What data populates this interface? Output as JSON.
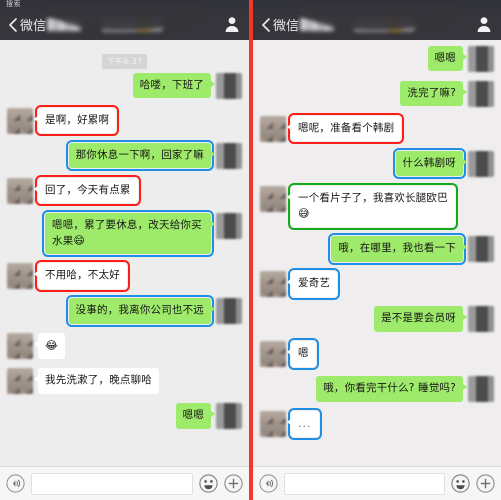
{
  "app": {
    "name": "WeChat",
    "accent_green": "#9eea6a",
    "divider_color": "#f0392b",
    "nav_bg": "#36353b"
  },
  "panels": [
    {
      "id": "left",
      "statusbar_text": "搜索",
      "nav": {
        "back_label": "微信",
        "contact_name_redacted": "▮▮▮▮",
        "title_redacted": "▮▮▮▮▮",
        "profile_icon": "person-icon"
      },
      "timestamp": "下午6:37",
      "messages": [
        {
          "side": "out",
          "type": "text",
          "text": "哈喽，下班了",
          "bubble": "green",
          "highlight": "none"
        },
        {
          "side": "in",
          "type": "text",
          "text": "是啊，好累啊",
          "bubble": "white",
          "highlight": "red"
        },
        {
          "side": "out",
          "type": "text",
          "text": "那你休息一下啊，回家了嘛",
          "bubble": "green",
          "highlight": "blue"
        },
        {
          "side": "in",
          "type": "text",
          "text": "回了，今天有点累",
          "bubble": "white",
          "highlight": "red"
        },
        {
          "side": "out",
          "type": "text",
          "text": "嗯嗯，累了要休息，改天给你买水果",
          "emoji": "😄",
          "bubble": "green",
          "highlight": "blue"
        },
        {
          "side": "in",
          "type": "text",
          "text": "不用哈，不太好",
          "bubble": "white",
          "highlight": "red"
        },
        {
          "side": "out",
          "type": "text",
          "text": "没事的，我离你公司也不远",
          "bubble": "green",
          "highlight": "blue"
        },
        {
          "side": "in",
          "type": "emoji",
          "text": "😂",
          "bubble": "white",
          "highlight": "none"
        },
        {
          "side": "in",
          "type": "text",
          "text": "我先洗漱了，晚点聊哈",
          "bubble": "white",
          "highlight": "none"
        },
        {
          "side": "out",
          "type": "text",
          "text": "嗯嗯",
          "bubble": "green",
          "highlight": "none"
        }
      ],
      "input": {
        "voice_icon": "voice-icon",
        "placeholder": "",
        "value": "",
        "emoji_icon": "smiley-icon",
        "plus_icon": "plus-icon"
      }
    },
    {
      "id": "right",
      "statusbar_text": "",
      "nav": {
        "back_label": "微信",
        "contact_name_redacted": "▮▮▮▮",
        "title_redacted": "▮▮▮▮▮",
        "profile_icon": "person-icon"
      },
      "timestamp": "",
      "messages": [
        {
          "side": "out",
          "type": "text",
          "text": "嗯嗯",
          "bubble": "green",
          "highlight": "none"
        },
        {
          "side": "out",
          "type": "text",
          "text": "洗完了嘛?",
          "bubble": "green",
          "highlight": "none"
        },
        {
          "side": "in",
          "type": "text",
          "text": "嗯呢，准备看个韩剧",
          "bubble": "white",
          "highlight": "red"
        },
        {
          "side": "out",
          "type": "text",
          "text": "什么韩剧呀",
          "bubble": "green",
          "highlight": "blue"
        },
        {
          "side": "in",
          "type": "text",
          "text": "一个看片子了，我喜欢长腿欧巴",
          "emoji": "😅",
          "bubble": "white",
          "highlight": "green"
        },
        {
          "side": "out",
          "type": "text",
          "text": "哦，在哪里，我也看一下",
          "bubble": "green",
          "highlight": "blue"
        },
        {
          "side": "in",
          "type": "text",
          "text": "爱奇艺",
          "bubble": "white",
          "highlight": "blue"
        },
        {
          "side": "out",
          "type": "text",
          "text": "是不是要会员呀",
          "bubble": "green",
          "highlight": "none"
        },
        {
          "side": "in",
          "type": "text",
          "text": "嗯",
          "bubble": "white",
          "highlight": "blue"
        },
        {
          "side": "out",
          "type": "text",
          "text": "哦，你看完干什么? 睡觉吗?",
          "bubble": "green",
          "highlight": "none"
        },
        {
          "side": "in",
          "type": "text",
          "text": "...",
          "bubble": "white",
          "highlight": "blue"
        }
      ],
      "input": {
        "voice_icon": "voice-icon",
        "placeholder": "",
        "value": "",
        "emoji_icon": "smiley-icon",
        "plus_icon": "plus-icon"
      }
    }
  ]
}
